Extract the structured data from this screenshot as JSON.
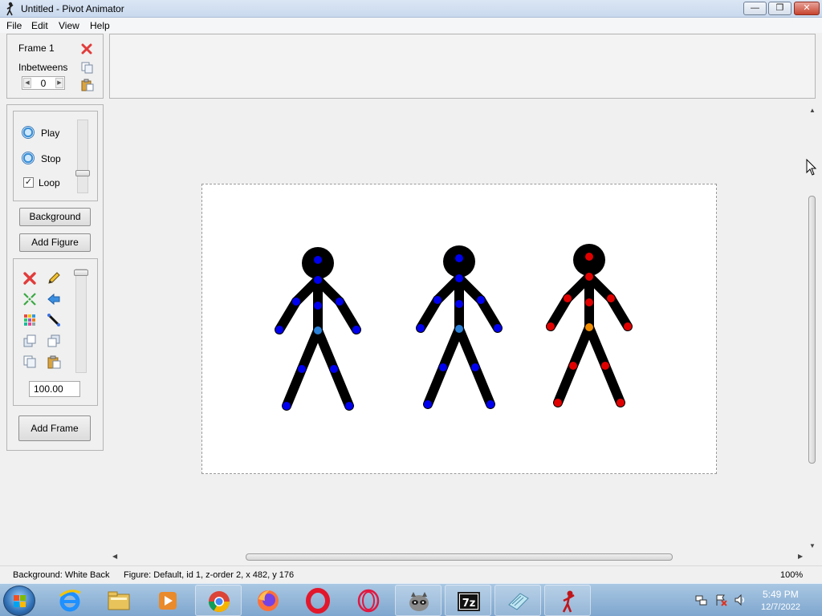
{
  "window": {
    "title": "Untitled - Pivot Animator",
    "minimize_glyph": "—",
    "maximize_glyph": "❐",
    "close_glyph": "✕"
  },
  "menu": {
    "items": [
      "File",
      "Edit",
      "View",
      "Help"
    ]
  },
  "frame_panel": {
    "frame_label": "Frame 1",
    "inbetweens_label": "Inbetweens",
    "inbetweens_value": "0"
  },
  "playback": {
    "play_label": "Play",
    "stop_label": "Stop",
    "loop_label": "Loop",
    "loop_checked_glyph": "✓",
    "speed_level": 0.75
  },
  "buttons": {
    "background": "Background",
    "add_figure": "Add Figure",
    "add_frame": "Add Frame"
  },
  "figure_tools": {
    "scale_value": "100.00",
    "scale_slider_level": 0.0,
    "icons": [
      "delete-figure-icon",
      "edit-figure-icon",
      "center-figure-icon",
      "flip-figure-icon",
      "color-figure-icon",
      "segment-tool-icon",
      "front-layer-icon",
      "back-layer-icon",
      "copy-figure-icon",
      "paste-figure-icon"
    ]
  },
  "figures": [
    {
      "name": "default-figure-1",
      "joint_color": "#0000ee",
      "selected": false
    },
    {
      "name": "default-figure-2",
      "joint_color": "#0000ee",
      "selected": false
    },
    {
      "name": "default-figure-3",
      "joint_color": "#e00000",
      "selected": true
    }
  ],
  "status": {
    "background": "Background: White Back",
    "figure": "Figure: Default,  id 1,  z-order 2,  x 482, y 176",
    "zoom": "100%"
  },
  "taskbar": {
    "apps": [
      "internet-explorer",
      "file-explorer",
      "media-player",
      "chrome",
      "firefox",
      "opera",
      "opera-gx",
      "raccoon-app",
      "7zip",
      "notepad",
      "pivot-animator"
    ],
    "time": "5:49 PM",
    "date": "12/7/2022"
  },
  "colors": {
    "joint_blue": "#0000ee",
    "joint_red": "#e00000",
    "joint_origin_blue": "#2a7fd6",
    "joint_origin_orange": "#f08c00"
  }
}
